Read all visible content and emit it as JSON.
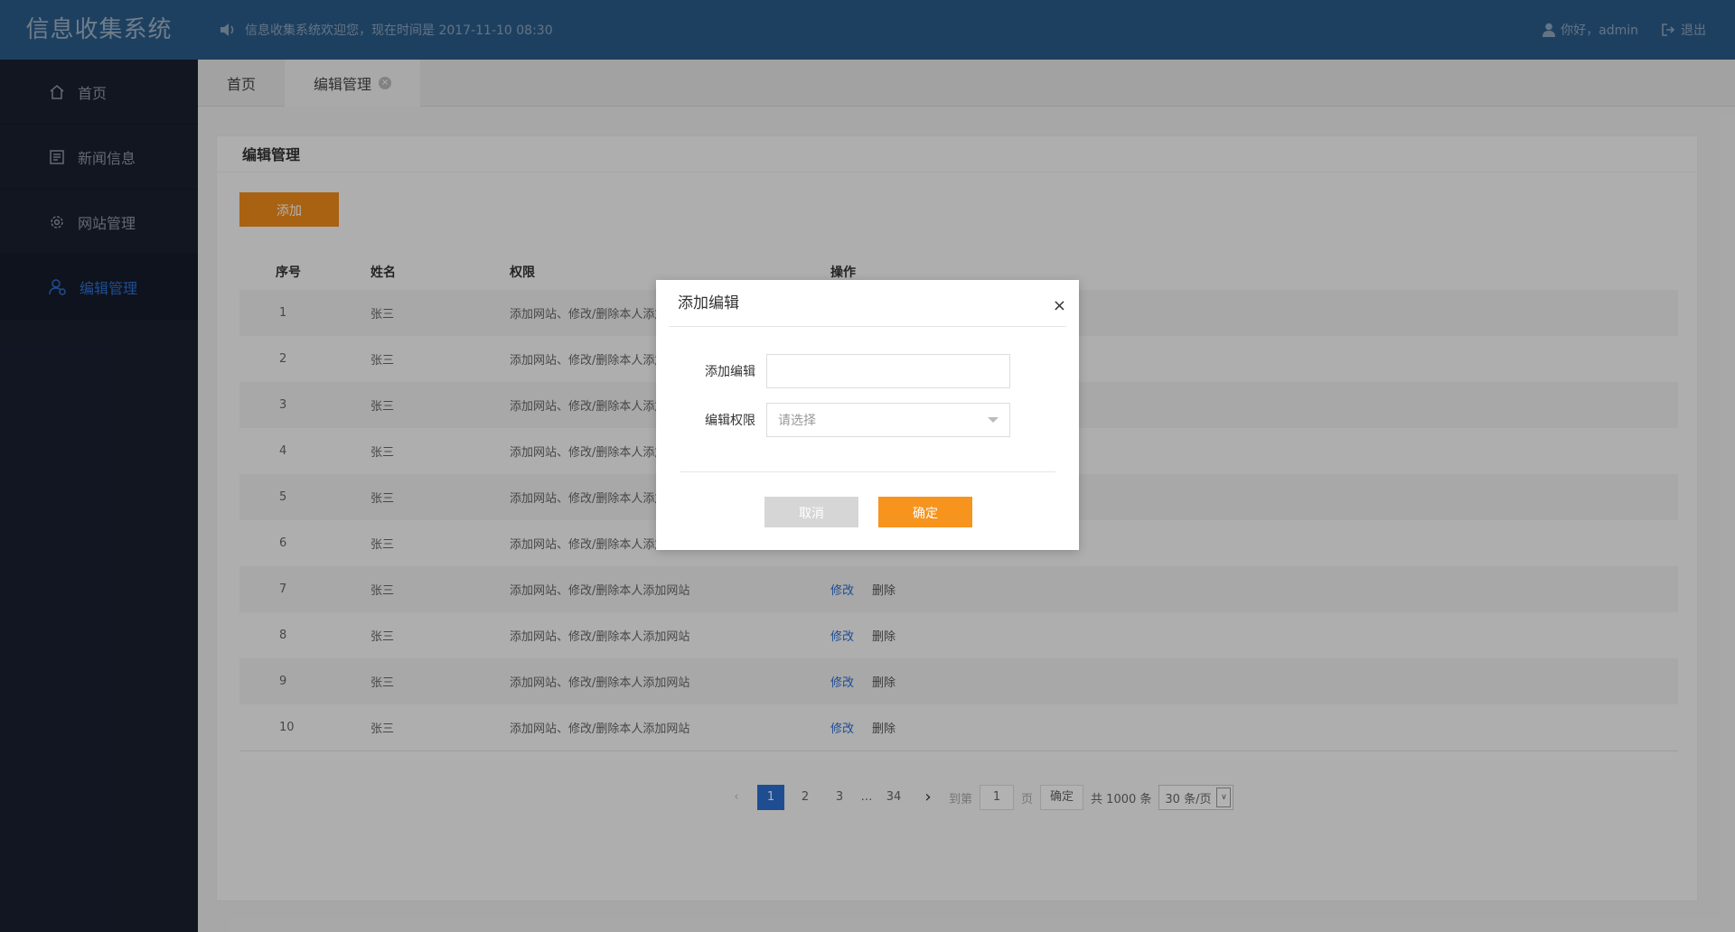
{
  "header": {
    "logo": "信息收集系统",
    "notice": "信息收集系统欢迎您，现在时间是 2017-11-10 08:30",
    "greeting": "你好，admin",
    "logout": "退出"
  },
  "sidebar": {
    "items": [
      {
        "label": "首页",
        "icon": "home-icon"
      },
      {
        "label": "新闻信息",
        "icon": "news-icon"
      },
      {
        "label": "网站管理",
        "icon": "gear-icon"
      },
      {
        "label": "编辑管理",
        "icon": "user-icon",
        "active": true
      }
    ]
  },
  "tabs": [
    {
      "label": "首页"
    },
    {
      "label": "编辑管理",
      "closable": true
    }
  ],
  "panel": {
    "title": "编辑管理",
    "add_label": "添加",
    "columns": [
      "序号",
      "姓名",
      "权限",
      "操作"
    ],
    "edit_label": "修改",
    "delete_label": "删除",
    "rows": [
      {
        "no": "1",
        "name": "张三",
        "perm": "添加网站、修改/删除本人添加网站"
      },
      {
        "no": "2",
        "name": "张三",
        "perm": "添加网站、修改/删除本人添加网站"
      },
      {
        "no": "3",
        "name": "张三",
        "perm": "添加网站、修改/删除本人添加网站"
      },
      {
        "no": "4",
        "name": "张三",
        "perm": "添加网站、修改/删除本人添加网站"
      },
      {
        "no": "5",
        "name": "张三",
        "perm": "添加网站、修改/删除本人添加网站"
      },
      {
        "no": "6",
        "name": "张三",
        "perm": "添加网站、修改/删除本人添加网站"
      },
      {
        "no": "7",
        "name": "张三",
        "perm": "添加网站、修改/删除本人添加网站"
      },
      {
        "no": "8",
        "name": "张三",
        "perm": "添加网站、修改/删除本人添加网站"
      },
      {
        "no": "9",
        "name": "张三",
        "perm": "添加网站、修改/删除本人添加网站"
      },
      {
        "no": "10",
        "name": "张三",
        "perm": "添加网站、修改/删除本人添加网站"
      }
    ]
  },
  "pager": {
    "pages": [
      "1",
      "2",
      "3",
      "…",
      "34"
    ],
    "goto_prefix": "到第",
    "goto_value": "1",
    "goto_suffix": "页",
    "confirm": "确定",
    "total": "共 1000 条",
    "per_page": "30 条/页"
  },
  "modal": {
    "title": "添加编辑",
    "close": "×",
    "name_label": "添加编辑",
    "name_value": "",
    "perm_label": "编辑权限",
    "perm_placeholder": "请选择",
    "cancel": "取消",
    "ok": "确定"
  },
  "colors": {
    "header": "#2b5c8a",
    "sidebar": "#1a2030",
    "accent": "#f28c1a",
    "link": "#2b6fd1"
  }
}
